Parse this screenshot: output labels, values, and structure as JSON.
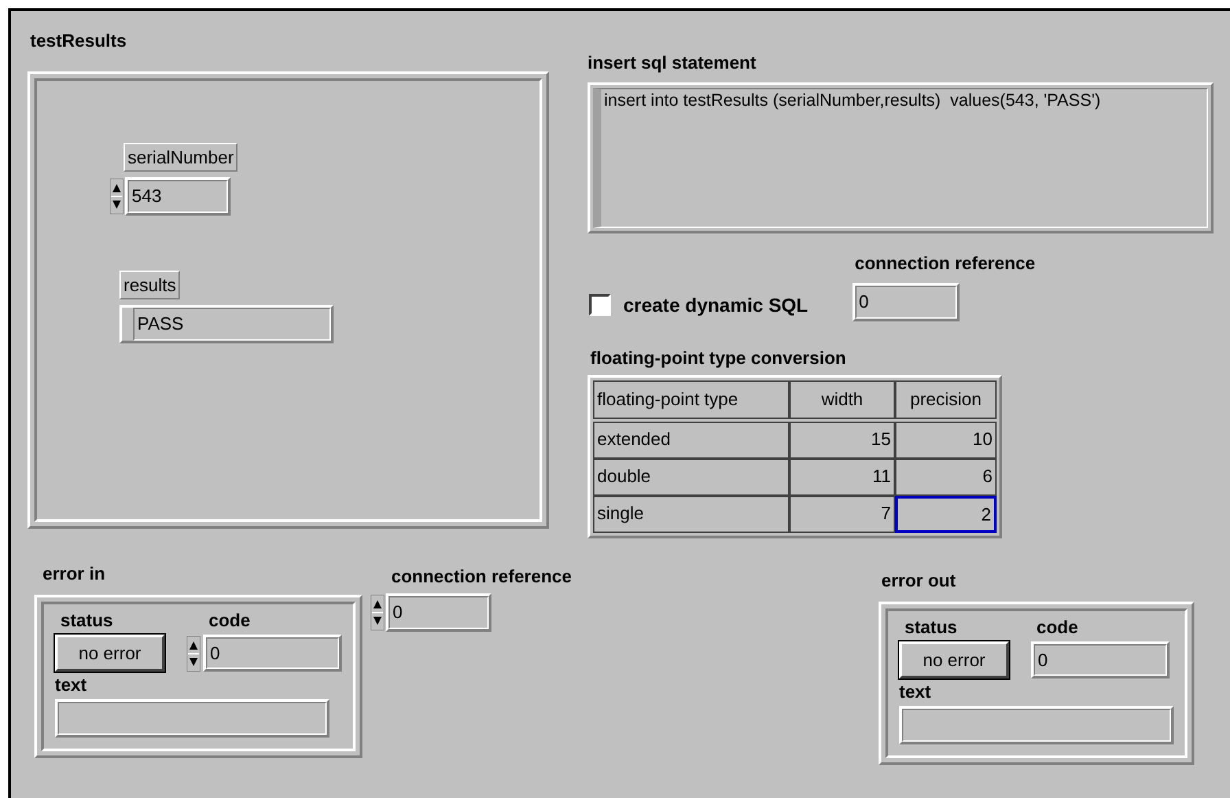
{
  "test_results": {
    "label": "testResults",
    "serial_number": {
      "label": "serialNumber",
      "value": "543"
    },
    "results": {
      "label": "results",
      "value": "PASS"
    }
  },
  "insert_sql_statement": {
    "label": "insert sql statement",
    "value": "insert into testResults (serialNumber,results)  values(543, 'PASS')"
  },
  "connection_reference_out": {
    "label": "connection reference",
    "value": "0"
  },
  "create_dynamic_sql": {
    "label": "create dynamic SQL",
    "checked": false
  },
  "type_conversion": {
    "label": "floating-point type conversion",
    "columns": [
      "floating-point type",
      "width",
      "precision"
    ],
    "rows": [
      {
        "cells": [
          {
            "text": "extended",
            "selected": false
          },
          {
            "text": "15",
            "selected": false
          },
          {
            "text": "10",
            "selected": false
          }
        ]
      },
      {
        "cells": [
          {
            "text": "double",
            "selected": false
          },
          {
            "text": "11",
            "selected": false
          },
          {
            "text": "6",
            "selected": false
          }
        ]
      },
      {
        "cells": [
          {
            "text": "single",
            "selected": false
          },
          {
            "text": "7",
            "selected": false
          },
          {
            "text": "2",
            "selected": true
          }
        ]
      }
    ]
  },
  "error_in": {
    "label": "error in",
    "status": {
      "label": "status",
      "value": "no error"
    },
    "code": {
      "label": "code",
      "value": "0"
    },
    "text": {
      "label": "text"
    }
  },
  "connection_reference_in": {
    "label": "connection reference",
    "value": "0"
  },
  "error_out": {
    "label": "error out",
    "status": {
      "label": "status",
      "value": "no error"
    },
    "code": {
      "label": "code",
      "value": "0"
    },
    "text": {
      "label": "text"
    }
  }
}
